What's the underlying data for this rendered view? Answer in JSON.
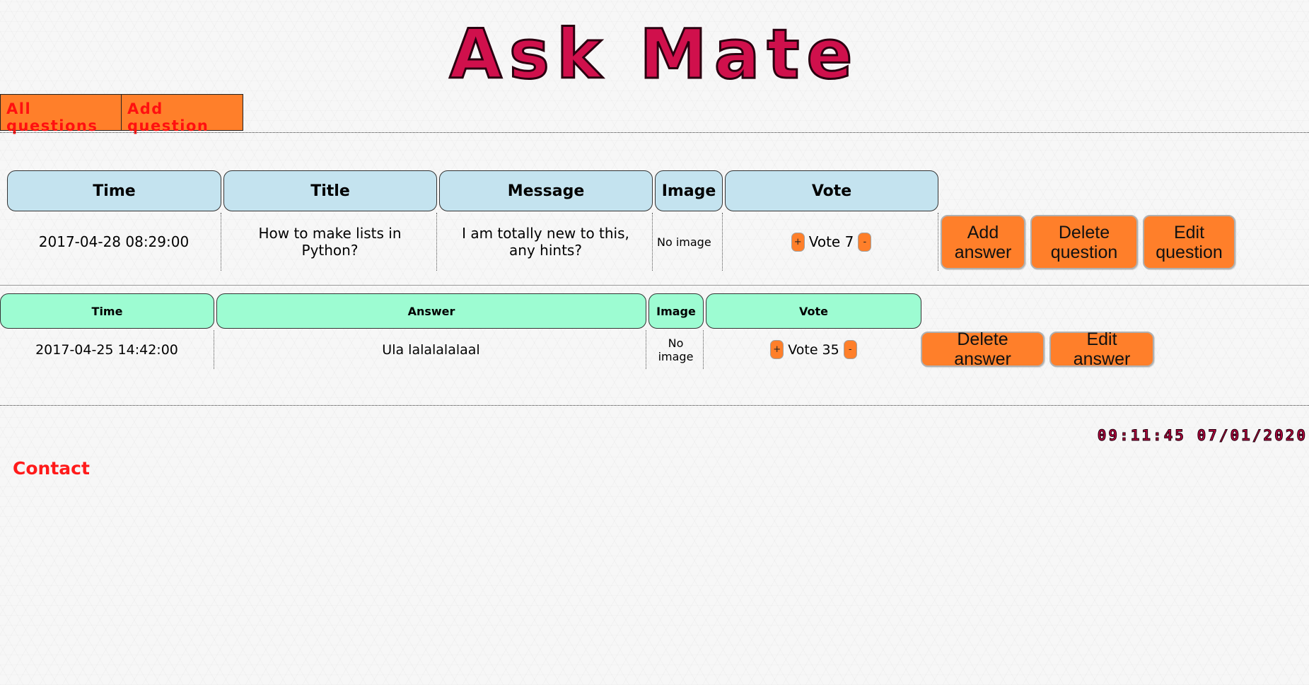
{
  "header": {
    "title": "Ask Mate"
  },
  "nav": {
    "all_questions": "All questions",
    "add_question": "Add question"
  },
  "question_table": {
    "columns": [
      "Time",
      "Title",
      "Message",
      "Image",
      "Vote"
    ],
    "row": {
      "time": "2017-04-28 08:29:00",
      "title": "How to make lists in Python?",
      "message": "I am totally new to this, any hints?",
      "image": "No image",
      "vote_label": "Vote 7",
      "vote_up": "+",
      "vote_down": "-"
    },
    "actions": {
      "add_answer": "Add answer",
      "delete_question": "Delete question",
      "edit_question": "Edit question"
    }
  },
  "answer_table": {
    "columns": [
      "Time",
      "Answer",
      "Image",
      "Vote"
    ],
    "row": {
      "time": "2017-04-25 14:42:00",
      "answer": "Ula lalalalalaal",
      "image": "No image",
      "vote_label": "Vote 35",
      "vote_up": "+",
      "vote_down": "-"
    },
    "actions": {
      "delete_answer": "Delete answer",
      "edit_answer": "Edit answer"
    }
  },
  "footer": {
    "clock": "09:11:45 07/01/2020",
    "contact": "Contact"
  },
  "colors": {
    "title": "#d0104c",
    "button": "#ff7f2a",
    "nav_text": "#ff1010",
    "question_header": "#c4e3ef",
    "answer_header": "#9dfcd2",
    "contact": "#ff1a1a"
  }
}
